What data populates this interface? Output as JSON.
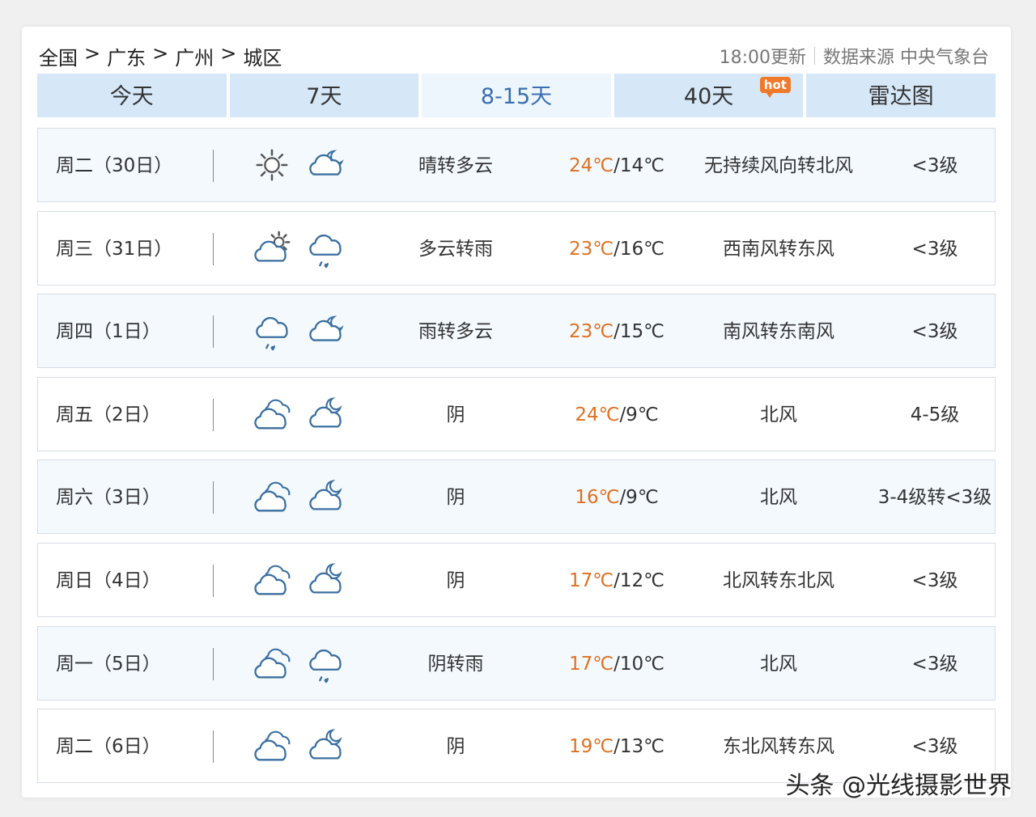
{
  "breadcrumb": [
    "全国",
    "广东",
    "广州",
    "城区"
  ],
  "breadcrumb_separator": ">",
  "meta": {
    "update": "18:00更新",
    "source": "数据来源 中央气象台"
  },
  "tabs": [
    {
      "label": "今天"
    },
    {
      "label": "7天"
    },
    {
      "label": "8-15天"
    },
    {
      "label": "40天"
    },
    {
      "label": "雷达图"
    }
  ],
  "hot_badge": "hot",
  "colors": {
    "tab_bg": "#d6e7f7",
    "tab_active_text": "#3a6fb0",
    "high_temp": "#e07020",
    "icon_stroke": "#3a6fa0",
    "sun": "#555555"
  },
  "forecast": [
    {
      "day": "周二（30日）",
      "icons": [
        "sun-icon",
        "cloud-moon-icon"
      ],
      "desc": "晴转多云",
      "high": "24℃",
      "low": "/14℃",
      "wind": "无持续风向转北风",
      "level": "<3级"
    },
    {
      "day": "周三（31日）",
      "icons": [
        "partly-cloudy-icon",
        "rain-icon"
      ],
      "desc": "多云转雨",
      "high": "23℃",
      "low": "/16℃",
      "wind": "西南风转东风",
      "level": "<3级"
    },
    {
      "day": "周四（1日）",
      "icons": [
        "rain-icon",
        "cloud-moon-icon"
      ],
      "desc": "雨转多云",
      "high": "23℃",
      "low": "/15℃",
      "wind": "南风转东南风",
      "level": "<3级"
    },
    {
      "day": "周五（2日）",
      "icons": [
        "overcast-icon",
        "overcast-night-icon"
      ],
      "desc": "阴",
      "high": "24℃",
      "low": "/9℃",
      "wind": "北风",
      "level": "4-5级"
    },
    {
      "day": "周六（3日）",
      "icons": [
        "overcast-icon",
        "overcast-night-icon"
      ],
      "desc": "阴",
      "high": "16℃",
      "low": "/9℃",
      "wind": "北风",
      "level": "3-4级转<3级"
    },
    {
      "day": "周日（4日）",
      "icons": [
        "overcast-icon",
        "overcast-night-icon"
      ],
      "desc": "阴",
      "high": "17℃",
      "low": "/12℃",
      "wind": "北风转东北风",
      "level": "<3级"
    },
    {
      "day": "周一（5日）",
      "icons": [
        "overcast-icon",
        "rain-icon"
      ],
      "desc": "阴转雨",
      "high": "17℃",
      "low": "/10℃",
      "wind": "北风",
      "level": "<3级"
    },
    {
      "day": "周二（6日）",
      "icons": [
        "overcast-icon",
        "overcast-night-icon"
      ],
      "desc": "阴",
      "high": "19℃",
      "low": "/13℃",
      "wind": "东北风转东风",
      "level": "<3级"
    }
  ],
  "watermark": "头条 @光线摄影世界"
}
